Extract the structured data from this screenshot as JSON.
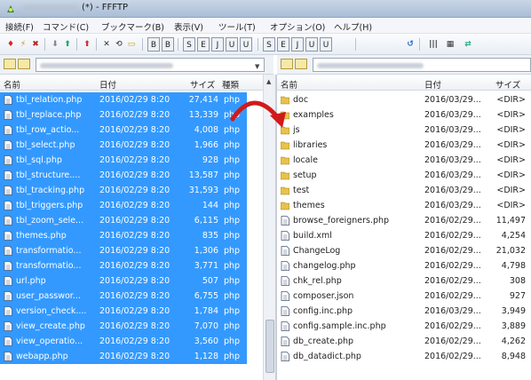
{
  "window": {
    "title": "(*) - FFFTP"
  },
  "colors": {
    "selection": "#3399ff",
    "folder": "#e8c24a",
    "arrow": "#d11a1a"
  },
  "menu": [
    {
      "label": "接続(F)"
    },
    {
      "label": "コマンド(C)"
    },
    {
      "label": "ブックマーク(B)"
    },
    {
      "label": "表示(V)"
    },
    {
      "label": "ツール(T)"
    },
    {
      "label": "オプション(O)"
    },
    {
      "label": "ヘルプ(H)"
    }
  ],
  "toolbar": {
    "buttons": [
      {
        "icon": "connect-icon",
        "glyph": "♦",
        "color": "#d22"
      },
      {
        "icon": "quick-connect-icon",
        "glyph": "⚡",
        "color": "#c80"
      },
      {
        "icon": "disconnect-icon",
        "glyph": "✖",
        "color": "#b22"
      },
      {
        "icon": "download-icon",
        "glyph": "⬇",
        "color": "#888"
      },
      {
        "icon": "upload-icon",
        "glyph": "⬆",
        "color": "#2a6"
      },
      {
        "icon": "up-folder-icon",
        "glyph": "⬆",
        "color": "#c33"
      },
      {
        "icon": "delete-icon",
        "glyph": "✕",
        "color": "#333"
      },
      {
        "icon": "rename-icon",
        "glyph": "⟲",
        "color": "#555"
      },
      {
        "icon": "new-folder-icon",
        "glyph": "▭",
        "color": "#c90"
      }
    ],
    "mode_buttons": [
      "B",
      "B",
      "S",
      "E",
      "J",
      "U",
      "U",
      "S",
      "E",
      "J",
      "U",
      "U"
    ],
    "right_buttons": [
      {
        "icon": "refresh-icon",
        "glyph": "↺",
        "color": "#2266cc"
      },
      {
        "icon": "list-view-icon",
        "glyph": "|||",
        "color": "#333"
      },
      {
        "icon": "detail-view-icon",
        "glyph": "▦",
        "color": "#333"
      },
      {
        "icon": "sync-icon",
        "glyph": "⇄",
        "color": "#2a8"
      }
    ]
  },
  "left_pane": {
    "headers": {
      "name": "名前",
      "date": "日付",
      "size": "サイズ",
      "type": "種類"
    },
    "files": [
      {
        "name": "tbl_relation.php",
        "date": "2016/02/29 8:20",
        "size": "27,414",
        "type": "php"
      },
      {
        "name": "tbl_replace.php",
        "date": "2016/02/29 8:20",
        "size": "13,339",
        "type": "php"
      },
      {
        "name": "tbl_row_actio...",
        "date": "2016/02/29 8:20",
        "size": "4,008",
        "type": "php"
      },
      {
        "name": "tbl_select.php",
        "date": "2016/02/29 8:20",
        "size": "1,966",
        "type": "php"
      },
      {
        "name": "tbl_sql.php",
        "date": "2016/02/29 8:20",
        "size": "928",
        "type": "php"
      },
      {
        "name": "tbl_structure....",
        "date": "2016/02/29 8:20",
        "size": "13,587",
        "type": "php"
      },
      {
        "name": "tbl_tracking.php",
        "date": "2016/02/29 8:20",
        "size": "31,593",
        "type": "php"
      },
      {
        "name": "tbl_triggers.php",
        "date": "2016/02/29 8:20",
        "size": "144",
        "type": "php"
      },
      {
        "name": "tbl_zoom_sele...",
        "date": "2016/02/29 8:20",
        "size": "6,115",
        "type": "php"
      },
      {
        "name": "themes.php",
        "date": "2016/02/29 8:20",
        "size": "835",
        "type": "php"
      },
      {
        "name": "transformatio...",
        "date": "2016/02/29 8:20",
        "size": "1,306",
        "type": "php"
      },
      {
        "name": "transformatio...",
        "date": "2016/02/29 8:20",
        "size": "3,771",
        "type": "php"
      },
      {
        "name": "url.php",
        "date": "2016/02/29 8:20",
        "size": "507",
        "type": "php"
      },
      {
        "name": "user_passwor...",
        "date": "2016/02/29 8:20",
        "size": "6,755",
        "type": "php"
      },
      {
        "name": "version_check....",
        "date": "2016/02/29 8:20",
        "size": "1,784",
        "type": "php"
      },
      {
        "name": "view_create.php",
        "date": "2016/02/29 8:20",
        "size": "7,070",
        "type": "php"
      },
      {
        "name": "view_operatio...",
        "date": "2016/02/29 8:20",
        "size": "3,560",
        "type": "php"
      },
      {
        "name": "webapp.php",
        "date": "2016/02/29 8:20",
        "size": "1,128",
        "type": "php"
      }
    ]
  },
  "right_pane": {
    "headers": {
      "name": "名前",
      "date": "日付",
      "size": "サイズ"
    },
    "files": [
      {
        "name": "doc",
        "date": "2016/03/29...",
        "size": "<DIR>",
        "kind": "folder"
      },
      {
        "name": "examples",
        "date": "2016/03/29...",
        "size": "<DIR>",
        "kind": "folder"
      },
      {
        "name": "js",
        "date": "2016/03/29...",
        "size": "<DIR>",
        "kind": "folder"
      },
      {
        "name": "libraries",
        "date": "2016/03/29...",
        "size": "<DIR>",
        "kind": "folder"
      },
      {
        "name": "locale",
        "date": "2016/03/29...",
        "size": "<DIR>",
        "kind": "folder"
      },
      {
        "name": "setup",
        "date": "2016/03/29...",
        "size": "<DIR>",
        "kind": "folder"
      },
      {
        "name": "test",
        "date": "2016/03/29...",
        "size": "<DIR>",
        "kind": "folder"
      },
      {
        "name": "themes",
        "date": "2016/03/29...",
        "size": "<DIR>",
        "kind": "folder"
      },
      {
        "name": "browse_foreigners.php",
        "date": "2016/02/29...",
        "size": "11,497",
        "kind": "file"
      },
      {
        "name": "build.xml",
        "date": "2016/02/29...",
        "size": "4,254",
        "kind": "file"
      },
      {
        "name": "ChangeLog",
        "date": "2016/02/29...",
        "size": "21,032",
        "kind": "file"
      },
      {
        "name": "changelog.php",
        "date": "2016/02/29...",
        "size": "4,798",
        "kind": "file"
      },
      {
        "name": "chk_rel.php",
        "date": "2016/02/29...",
        "size": "308",
        "kind": "file"
      },
      {
        "name": "composer.json",
        "date": "2016/02/29...",
        "size": "927",
        "kind": "file"
      },
      {
        "name": "config.inc.php",
        "date": "2016/03/29...",
        "size": "3,949",
        "kind": "file"
      },
      {
        "name": "config.sample.inc.php",
        "date": "2016/02/29...",
        "size": "3,889",
        "kind": "file"
      },
      {
        "name": "db_create.php",
        "date": "2016/02/29...",
        "size": "4,262",
        "kind": "file"
      },
      {
        "name": "db_datadict.php",
        "date": "2016/02/29...",
        "size": "8,948",
        "kind": "file"
      }
    ]
  }
}
